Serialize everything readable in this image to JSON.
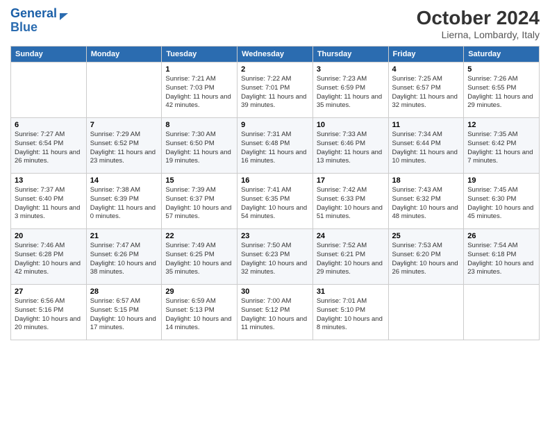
{
  "header": {
    "logo_line1": "General",
    "logo_line2": "Blue",
    "title": "October 2024",
    "subtitle": "Lierna, Lombardy, Italy"
  },
  "days_of_week": [
    "Sunday",
    "Monday",
    "Tuesday",
    "Wednesday",
    "Thursday",
    "Friday",
    "Saturday"
  ],
  "weeks": [
    [
      {
        "day": "",
        "info": ""
      },
      {
        "day": "",
        "info": ""
      },
      {
        "day": "1",
        "info": "Sunrise: 7:21 AM\nSunset: 7:03 PM\nDaylight: 11 hours and 42 minutes."
      },
      {
        "day": "2",
        "info": "Sunrise: 7:22 AM\nSunset: 7:01 PM\nDaylight: 11 hours and 39 minutes."
      },
      {
        "day": "3",
        "info": "Sunrise: 7:23 AM\nSunset: 6:59 PM\nDaylight: 11 hours and 35 minutes."
      },
      {
        "day": "4",
        "info": "Sunrise: 7:25 AM\nSunset: 6:57 PM\nDaylight: 11 hours and 32 minutes."
      },
      {
        "day": "5",
        "info": "Sunrise: 7:26 AM\nSunset: 6:55 PM\nDaylight: 11 hours and 29 minutes."
      }
    ],
    [
      {
        "day": "6",
        "info": "Sunrise: 7:27 AM\nSunset: 6:54 PM\nDaylight: 11 hours and 26 minutes."
      },
      {
        "day": "7",
        "info": "Sunrise: 7:29 AM\nSunset: 6:52 PM\nDaylight: 11 hours and 23 minutes."
      },
      {
        "day": "8",
        "info": "Sunrise: 7:30 AM\nSunset: 6:50 PM\nDaylight: 11 hours and 19 minutes."
      },
      {
        "day": "9",
        "info": "Sunrise: 7:31 AM\nSunset: 6:48 PM\nDaylight: 11 hours and 16 minutes."
      },
      {
        "day": "10",
        "info": "Sunrise: 7:33 AM\nSunset: 6:46 PM\nDaylight: 11 hours and 13 minutes."
      },
      {
        "day": "11",
        "info": "Sunrise: 7:34 AM\nSunset: 6:44 PM\nDaylight: 11 hours and 10 minutes."
      },
      {
        "day": "12",
        "info": "Sunrise: 7:35 AM\nSunset: 6:42 PM\nDaylight: 11 hours and 7 minutes."
      }
    ],
    [
      {
        "day": "13",
        "info": "Sunrise: 7:37 AM\nSunset: 6:40 PM\nDaylight: 11 hours and 3 minutes."
      },
      {
        "day": "14",
        "info": "Sunrise: 7:38 AM\nSunset: 6:39 PM\nDaylight: 11 hours and 0 minutes."
      },
      {
        "day": "15",
        "info": "Sunrise: 7:39 AM\nSunset: 6:37 PM\nDaylight: 10 hours and 57 minutes."
      },
      {
        "day": "16",
        "info": "Sunrise: 7:41 AM\nSunset: 6:35 PM\nDaylight: 10 hours and 54 minutes."
      },
      {
        "day": "17",
        "info": "Sunrise: 7:42 AM\nSunset: 6:33 PM\nDaylight: 10 hours and 51 minutes."
      },
      {
        "day": "18",
        "info": "Sunrise: 7:43 AM\nSunset: 6:32 PM\nDaylight: 10 hours and 48 minutes."
      },
      {
        "day": "19",
        "info": "Sunrise: 7:45 AM\nSunset: 6:30 PM\nDaylight: 10 hours and 45 minutes."
      }
    ],
    [
      {
        "day": "20",
        "info": "Sunrise: 7:46 AM\nSunset: 6:28 PM\nDaylight: 10 hours and 42 minutes."
      },
      {
        "day": "21",
        "info": "Sunrise: 7:47 AM\nSunset: 6:26 PM\nDaylight: 10 hours and 38 minutes."
      },
      {
        "day": "22",
        "info": "Sunrise: 7:49 AM\nSunset: 6:25 PM\nDaylight: 10 hours and 35 minutes."
      },
      {
        "day": "23",
        "info": "Sunrise: 7:50 AM\nSunset: 6:23 PM\nDaylight: 10 hours and 32 minutes."
      },
      {
        "day": "24",
        "info": "Sunrise: 7:52 AM\nSunset: 6:21 PM\nDaylight: 10 hours and 29 minutes."
      },
      {
        "day": "25",
        "info": "Sunrise: 7:53 AM\nSunset: 6:20 PM\nDaylight: 10 hours and 26 minutes."
      },
      {
        "day": "26",
        "info": "Sunrise: 7:54 AM\nSunset: 6:18 PM\nDaylight: 10 hours and 23 minutes."
      }
    ],
    [
      {
        "day": "27",
        "info": "Sunrise: 6:56 AM\nSunset: 5:16 PM\nDaylight: 10 hours and 20 minutes."
      },
      {
        "day": "28",
        "info": "Sunrise: 6:57 AM\nSunset: 5:15 PM\nDaylight: 10 hours and 17 minutes."
      },
      {
        "day": "29",
        "info": "Sunrise: 6:59 AM\nSunset: 5:13 PM\nDaylight: 10 hours and 14 minutes."
      },
      {
        "day": "30",
        "info": "Sunrise: 7:00 AM\nSunset: 5:12 PM\nDaylight: 10 hours and 11 minutes."
      },
      {
        "day": "31",
        "info": "Sunrise: 7:01 AM\nSunset: 5:10 PM\nDaylight: 10 hours and 8 minutes."
      },
      {
        "day": "",
        "info": ""
      },
      {
        "day": "",
        "info": ""
      }
    ]
  ]
}
